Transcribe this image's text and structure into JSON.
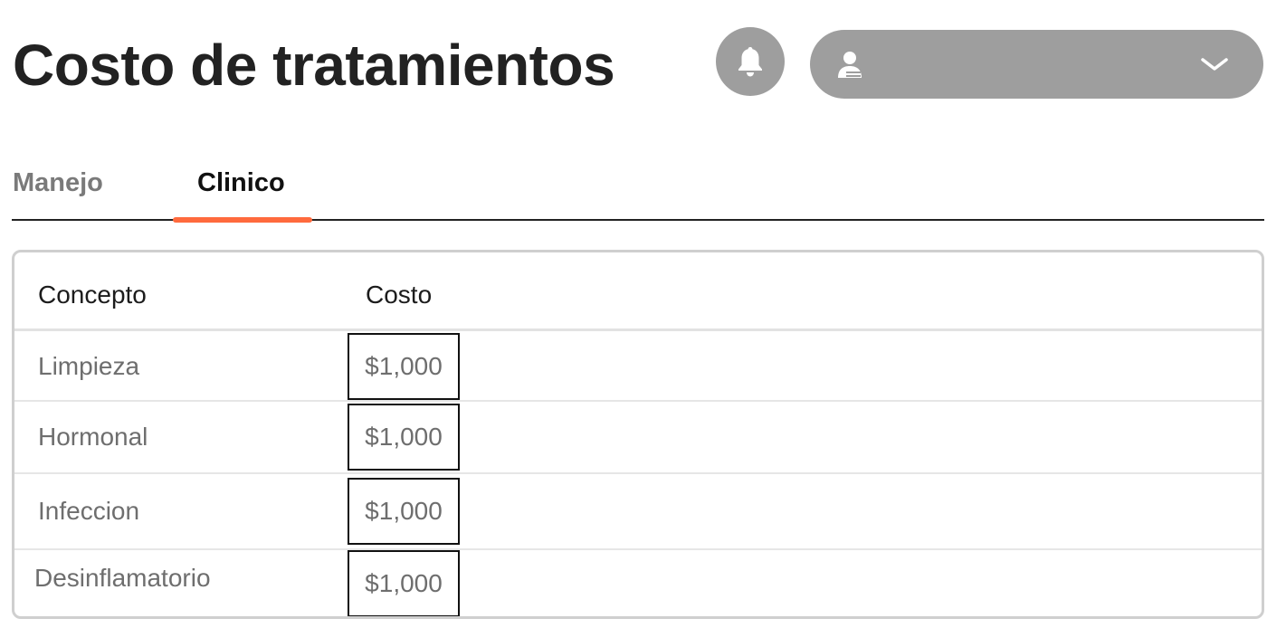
{
  "header": {
    "title": "Costo de tratamientos",
    "notification_icon": "bell-icon",
    "user_menu": {
      "icon": "user-icon",
      "value": "",
      "chevron_icon": "chevron-down-icon"
    }
  },
  "tabs": [
    {
      "label": "Manejo",
      "active": false
    },
    {
      "label": "Clinico",
      "active": true
    }
  ],
  "colors": {
    "accent": "#ff6a3d",
    "header_controls": "#9e9e9e",
    "title": "#222222"
  },
  "table": {
    "columns": [
      "Concepto",
      "Costo"
    ],
    "rows": [
      {
        "concepto": "Limpieza",
        "costo": "$1,000"
      },
      {
        "concepto": "Hormonal",
        "costo": "$1,000"
      },
      {
        "concepto": "Infeccion",
        "costo": "$1,000"
      },
      {
        "concepto": "Desinflamatorio",
        "costo": "$1,000"
      }
    ]
  }
}
